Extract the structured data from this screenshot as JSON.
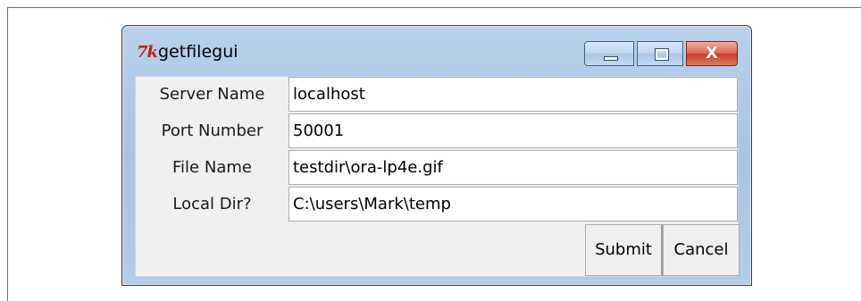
{
  "window": {
    "title": "getfilegui",
    "app_icon_text": "7k",
    "buttons": {
      "minimize": "minimize",
      "maximize": "maximize",
      "close": "X"
    }
  },
  "form": {
    "rows": [
      {
        "label": "Server Name",
        "value": "localhost"
      },
      {
        "label": "Port Number",
        "value": "50001"
      },
      {
        "label": "File Name",
        "value": "testdir\\ora-lp4e.gif"
      },
      {
        "label": "Local Dir?",
        "value": "C:\\users\\Mark\\temp"
      }
    ]
  },
  "actions": {
    "submit_label": "Submit",
    "cancel_label": "Cancel"
  }
}
